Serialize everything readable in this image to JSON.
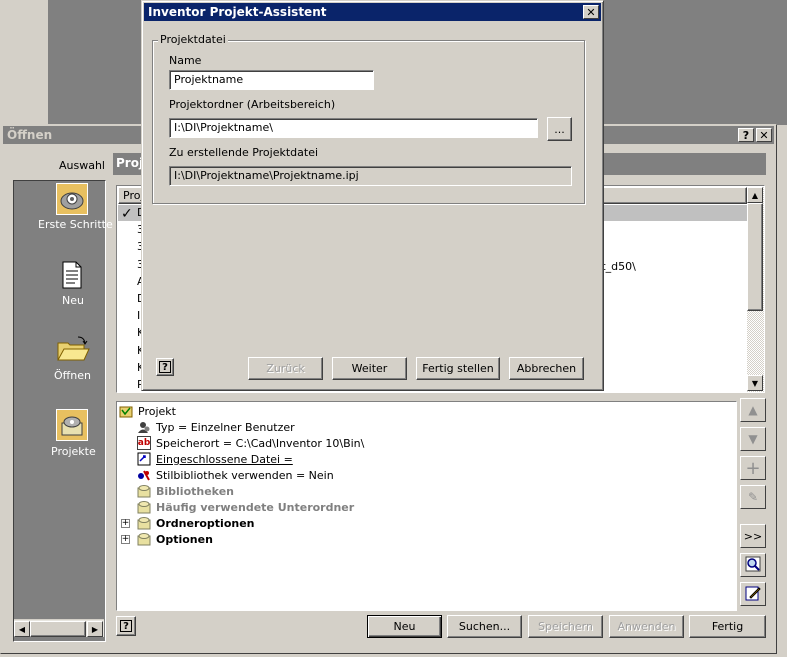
{
  "open_dialog": {
    "title": "Öffnen",
    "help_btn": "?",
    "close_btn": "✕",
    "left_panel": {
      "header": "Auswahl",
      "items": [
        {
          "label": "Erste Schritte",
          "icon": "getting-started-icon"
        },
        {
          "label": "Neu",
          "icon": "new-document-icon"
        },
        {
          "label": "Öffnen",
          "icon": "open-folder-icon"
        },
        {
          "label": "Projekte",
          "icon": "projects-icon"
        }
      ]
    },
    "projects_header": "Proje",
    "list_header": "Proj",
    "list_rows": [
      "D",
      "3",
      "3",
      "3",
      "A",
      "D",
      "I",
      "K",
      "K",
      "K",
      "P"
    ],
    "list_partial_text": "kt_d50\\",
    "tree": [
      {
        "label": "Projekt",
        "style": "normal"
      },
      {
        "label": "Typ = Einzelner Benutzer",
        "style": "normal"
      },
      {
        "label": "Speicherort = C:\\Cad\\Inventor 10\\Bin\\",
        "style": "normal"
      },
      {
        "label": "Eingeschlossene Datei = ",
        "style": "underline"
      },
      {
        "label": "Stilbibliothek verwenden = Nein",
        "style": "normal"
      },
      {
        "label": "Bibliotheken",
        "style": "gray"
      },
      {
        "label": "Häufig verwendete Unterordner",
        "style": "gray"
      },
      {
        "label": "Ordneroptionen",
        "style": "bold"
      },
      {
        "label": "Optionen",
        "style": "bold"
      }
    ],
    "side_buttons": {
      "more": ">>"
    },
    "buttons": {
      "new": "Neu",
      "search": "Suchen...",
      "save": "Speichern",
      "apply": "Anwenden",
      "done": "Fertig"
    }
  },
  "wizard": {
    "title": "Inventor Projekt-Assistent",
    "close_btn": "✕",
    "group_label": "Projektdatei",
    "name_label": "Name",
    "name_value": "Projektname",
    "folder_label": "Projektordner (Arbeitsbereich)",
    "folder_value": "I:\\DI\\Projektname\\",
    "browse_btn": "...",
    "file_label": "Zu erstellende Projektdatei",
    "file_value": "I:\\DI\\Projektname\\Projektname.ipj",
    "help_btn": "?",
    "buttons": {
      "back": "Zurück",
      "next": "Weiter",
      "finish": "Fertig stellen",
      "cancel": "Abbrechen"
    }
  },
  "colors": {
    "active_title": "#0a246a",
    "inactive_title": "#808080",
    "face": "#d4d0c8",
    "sidebar": "#808080",
    "selection": "#c0c0c0"
  }
}
